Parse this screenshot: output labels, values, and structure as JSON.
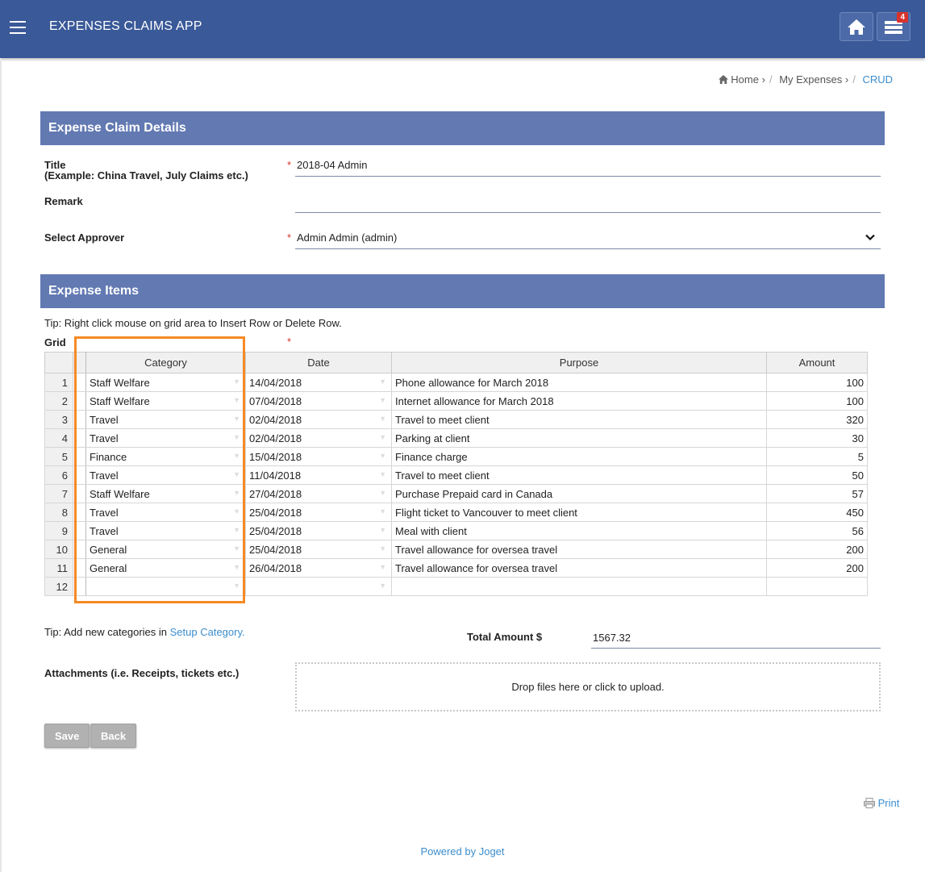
{
  "app": {
    "title": "EXPENSES CLAIMS APP",
    "notification_count": "4"
  },
  "breadcrumb": {
    "home": "Home",
    "my_expenses": "My Expenses",
    "current": "CRUD"
  },
  "claim_details": {
    "header": "Expense Claim Details",
    "title_label": "Title",
    "title_example": "(Example: China Travel, July Claims etc.)",
    "title_value": "2018-04 Admin",
    "remark_label": "Remark",
    "remark_value": "",
    "approver_label": "Select Approver",
    "approver_value": "Admin Admin (admin)"
  },
  "expense_items": {
    "header": "Expense Items",
    "tip": "Tip: Right click mouse on grid area to Insert Row or Delete Row.",
    "grid_label": "Grid",
    "columns": [
      "Category",
      "Date",
      "Purpose",
      "Amount"
    ],
    "rows": [
      {
        "n": "1",
        "category": "Staff Welfare",
        "date": "14/04/2018",
        "purpose": "Phone allowance for March 2018",
        "amount": "100"
      },
      {
        "n": "2",
        "category": "Staff Welfare",
        "date": "07/04/2018",
        "purpose": "Internet allowance for March 2018",
        "amount": "100"
      },
      {
        "n": "3",
        "category": "Travel",
        "date": "02/04/2018",
        "purpose": "Travel to meet client",
        "amount": "320"
      },
      {
        "n": "4",
        "category": "Travel",
        "date": "02/04/2018",
        "purpose": "Parking at client",
        "amount": "30"
      },
      {
        "n": "5",
        "category": "Finance",
        "date": "15/04/2018",
        "purpose": "Finance charge",
        "amount": "5"
      },
      {
        "n": "6",
        "category": "Travel",
        "date": "11/04/2018",
        "purpose": "Travel to meet client",
        "amount": "50"
      },
      {
        "n": "7",
        "category": "Staff Welfare",
        "date": "27/04/2018",
        "purpose": "Purchase Prepaid card in Canada",
        "amount": "57"
      },
      {
        "n": "8",
        "category": "Travel",
        "date": "25/04/2018",
        "purpose": "Flight ticket to Vancouver to meet client",
        "amount": "450"
      },
      {
        "n": "9",
        "category": "Travel",
        "date": "25/04/2018",
        "purpose": "Meal with client",
        "amount": "56"
      },
      {
        "n": "10",
        "category": "General",
        "date": "25/04/2018",
        "purpose": "Travel allowance for oversea travel",
        "amount": "200"
      },
      {
        "n": "11",
        "category": "General",
        "date": "26/04/2018",
        "purpose": "Travel allowance for oversea travel",
        "amount": "200"
      },
      {
        "n": "12",
        "category": "",
        "date": "",
        "purpose": "",
        "amount": ""
      }
    ],
    "category_tip_prefix": "Tip: Add new categories in",
    "category_tip_link": "Setup Category.",
    "total_label": "Total Amount $",
    "total_value": "1567.32",
    "attachments_label": "Attachments (i.e. Receipts, tickets etc.)",
    "dropzone_text": "Drop files here or click to upload."
  },
  "buttons": {
    "save": "Save",
    "back": "Back"
  },
  "print_label": "Print",
  "footer": "Powered by Joget",
  "colors": {
    "topbar": "#3a5998",
    "section_header": "#6279b2",
    "link": "#3c8dcd",
    "highlight": "#f58a24",
    "required": "#d9322b"
  }
}
